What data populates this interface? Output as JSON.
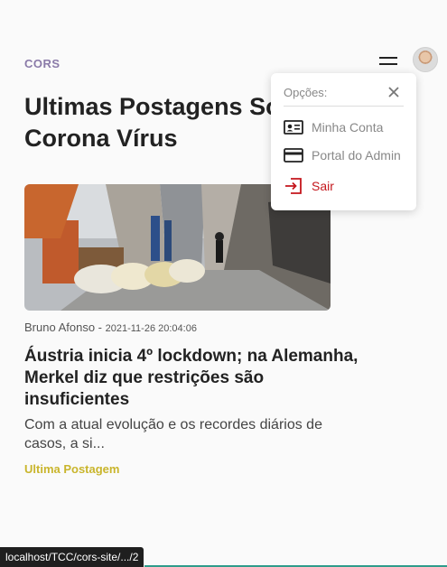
{
  "header": {
    "brand": "CORS"
  },
  "main": {
    "title": "Ultimas Postagens Sobre Corona Vírus",
    "post": {
      "author": "Bruno Afonso",
      "separator": " - ",
      "date": "2021-11-26 20:04:06",
      "title": "Áustria inicia 4º lockdown; na Alemanha, Merkel diz que restrições são insuficientes",
      "excerpt": "Com a atual evolução e os recordes diários de casos, a si...",
      "tag": "Ultima Postagem"
    }
  },
  "dropdown": {
    "heading": "Opções:",
    "items": [
      {
        "label": "Minha Conta",
        "icon": "id-card-icon"
      },
      {
        "label": "Portal do Admin",
        "icon": "credit-card-icon"
      },
      {
        "label": "Sair",
        "icon": "logout-icon"
      }
    ]
  },
  "status_bar": {
    "url": "localhost/TCC/cors-site/.../2"
  },
  "colors": {
    "brand": "#8a7aa8",
    "tag": "#c9b52c",
    "danger": "#c4161c"
  }
}
